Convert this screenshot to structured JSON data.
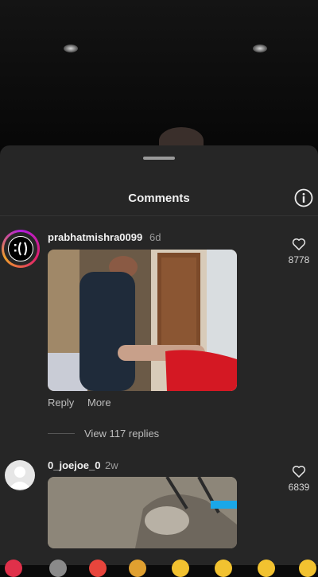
{
  "sheet": {
    "title": "Comments"
  },
  "comments": [
    {
      "username": "prabhatmishra0099",
      "time": "6d",
      "likes": "8778",
      "reply_label": "Reply",
      "more_label": "More",
      "view_replies": "View 117 replies"
    },
    {
      "username": "0_joejoe_0",
      "time": "2w",
      "likes": "6839"
    }
  ],
  "icons": {
    "info": "info-icon",
    "like": "heart-outline-icon",
    "avatar_default": "person-silhouette-icon"
  },
  "colors": {
    "sheet_background": "#262626",
    "story_ring_start": "#b11be0",
    "story_ring_end": "#f0a02b"
  }
}
